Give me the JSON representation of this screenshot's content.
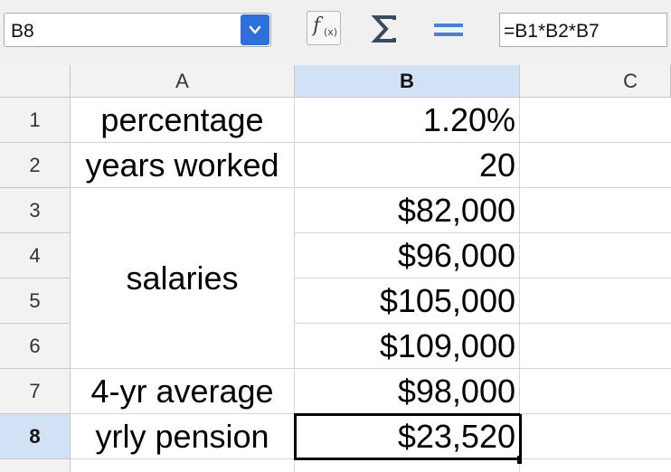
{
  "toolbar": {
    "name_box": "B8",
    "function_wizard_icon": "fx-icon",
    "sum_icon": "sigma-icon",
    "formula_icon": "equals-icon",
    "formula": "=B1*B2*B7"
  },
  "columns": [
    "A",
    "B",
    "C"
  ],
  "rows": [
    "1",
    "2",
    "3",
    "4",
    "5",
    "6",
    "7",
    "8"
  ],
  "cells": {
    "A1": "percentage",
    "A2": "years worked",
    "A3_6": "salaries",
    "A7": "4-yr average",
    "A8": "yrly pension",
    "B1": "1.20%",
    "B2": "20",
    "B3": "$82,000",
    "B4": "$96,000",
    "B5": "$105,000",
    "B6": "$109,000",
    "B7": "$98,000",
    "B8": "$23,520"
  },
  "colors": {
    "accent": "#2f6fd9",
    "selected_header": "#d3e1f7"
  }
}
